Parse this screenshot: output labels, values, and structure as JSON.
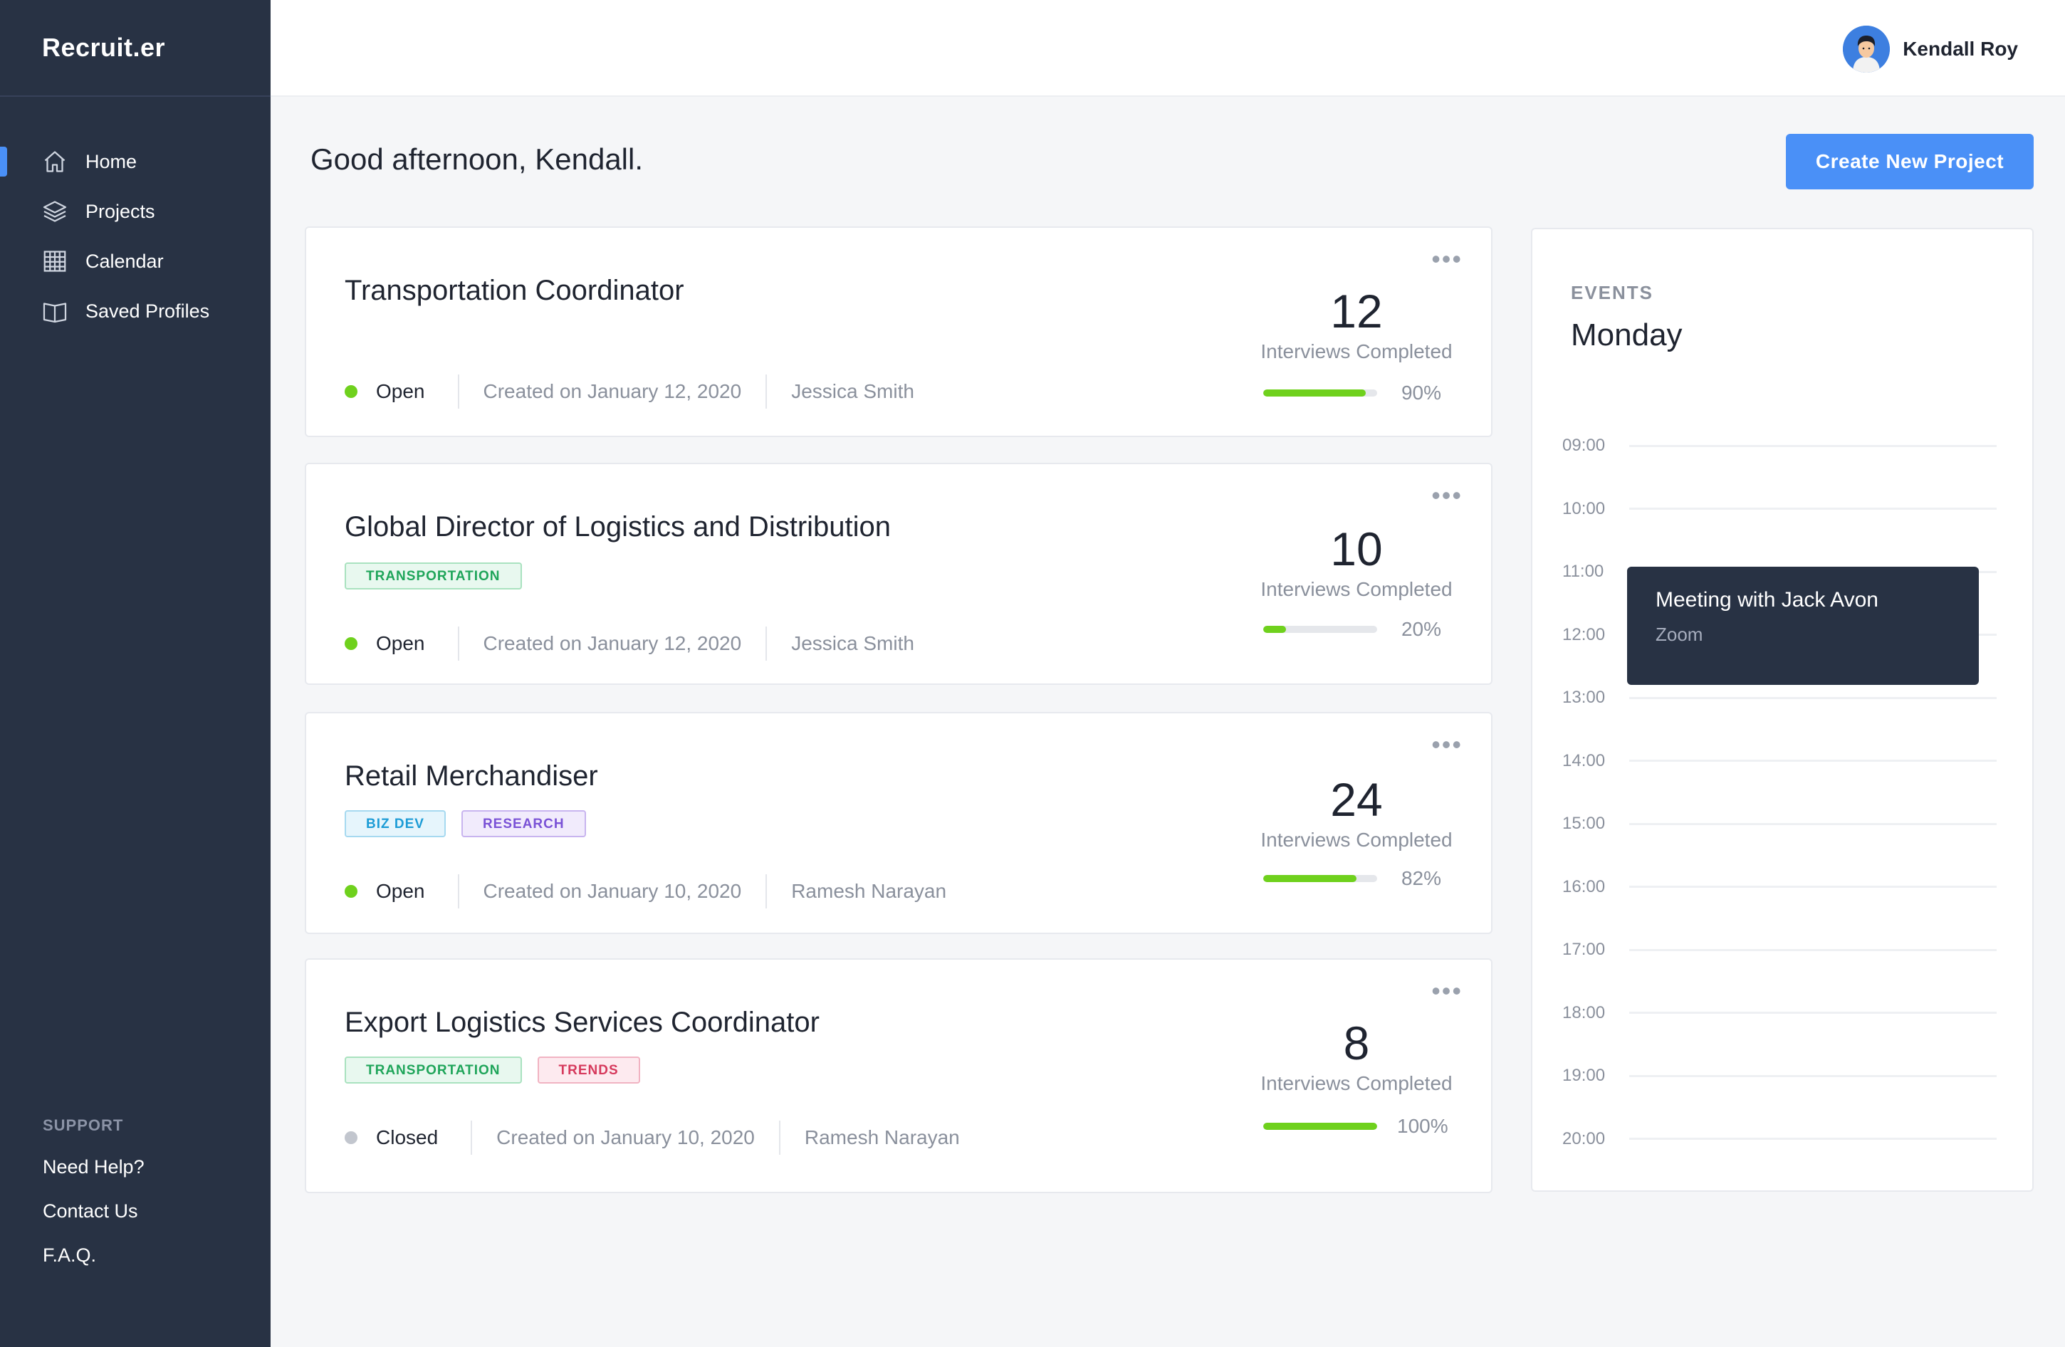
{
  "app": {
    "brand": "Recruit.er"
  },
  "sidebar": {
    "items": [
      {
        "label": "Home",
        "icon": "home-icon",
        "active": true
      },
      {
        "label": "Projects",
        "icon": "layers-icon",
        "active": false
      },
      {
        "label": "Calendar",
        "icon": "calendar-icon",
        "active": false
      },
      {
        "label": "Saved Profiles",
        "icon": "book-icon",
        "active": false
      }
    ],
    "support": {
      "title": "SUPPORT",
      "links": [
        "Need Help?",
        "Contact Us",
        "F.A.Q."
      ]
    }
  },
  "header": {
    "username": "Kendall Roy"
  },
  "main": {
    "greeting": "Good afternoon, Kendall.",
    "create_button": "Create New Project",
    "projects": [
      {
        "title": "Transportation Coordinator",
        "tags": [],
        "status": "Open",
        "created": "Created on January 12, 2020",
        "owner": "Jessica Smith",
        "interviews": "12",
        "interviews_label": "Interviews Completed",
        "progress": 0.9,
        "progress_label": "90%"
      },
      {
        "title": "Global Director of Logistics and Distribution",
        "tags": [
          "TRANSPORTATION"
        ],
        "status": "Open",
        "created": "Created on January 12, 2020",
        "owner": "Jessica Smith",
        "interviews": "10",
        "interviews_label": "Interviews Completed",
        "progress": 0.2,
        "progress_label": "20%"
      },
      {
        "title": "Retail Merchandiser",
        "tags": [
          "BIZ DEV",
          "RESEARCH"
        ],
        "status": "Open",
        "created": "Created on January 10, 2020",
        "owner": "Ramesh Narayan",
        "interviews": "24",
        "interviews_label": "Interviews Completed",
        "progress": 0.82,
        "progress_label": "82%"
      },
      {
        "title": "Export Logistics Services Coordinator",
        "tags": [
          "TRANSPORTATION",
          "TRENDS"
        ],
        "status": "Closed",
        "created": "Created on January 10, 2020",
        "owner": "Ramesh Narayan",
        "interviews": "8",
        "interviews_label": "Interviews Completed",
        "progress": 1.0,
        "progress_label": "100%"
      }
    ]
  },
  "events": {
    "label": "EVENTS",
    "day": "Monday",
    "times": [
      "09:00",
      "10:00",
      "11:00",
      "12:00",
      "13:00",
      "14:00",
      "15:00",
      "16:00",
      "17:00",
      "18:00",
      "19:00",
      "20:00"
    ],
    "event": {
      "title": "Meeting with Jack Avon",
      "subtitle": "Zoom"
    }
  },
  "colors": {
    "sidebar": "#283244",
    "accent": "#4a90f7",
    "open": "#6fd11d",
    "closed": "#c2c6ce",
    "progress": "#6fd11d"
  }
}
